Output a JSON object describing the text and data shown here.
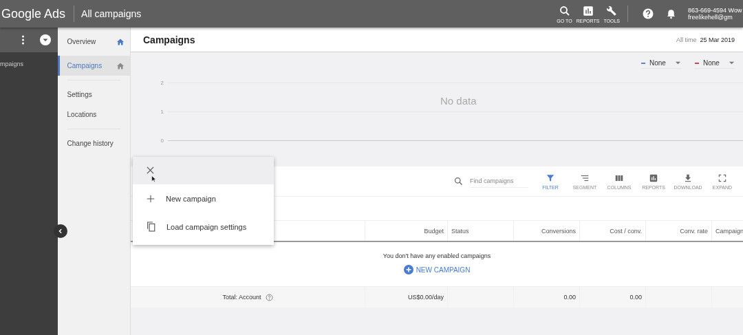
{
  "top_bar": {
    "logo": "Google Ads",
    "title": "All campaigns",
    "actions": [
      {
        "kind": "search",
        "label": "GO TO"
      },
      {
        "kind": "reports",
        "label": "REPORTS"
      },
      {
        "kind": "tools",
        "label": "TOOLS"
      }
    ],
    "account": {
      "phone": "863-669-4594 Wow",
      "email": "freelikehell@gm"
    }
  },
  "account_panel": {
    "item": "mpaigns"
  },
  "nav": [
    {
      "label": "Overview",
      "selected": false,
      "home": true
    },
    {
      "label": "Campaigns",
      "selected": true,
      "home": true
    },
    {
      "kind": "divider"
    },
    {
      "label": "Settings",
      "selected": false,
      "home": false
    },
    {
      "label": "Locations",
      "selected": false,
      "home": false
    },
    {
      "kind": "divider"
    },
    {
      "label": "Change history",
      "selected": false,
      "home": false
    }
  ],
  "header": {
    "title": "Campaigns",
    "range_label": "All time",
    "date": "25 Mar 2019"
  },
  "chart": {
    "metrics": [
      {
        "label": "None",
        "color": "#5a86c9"
      },
      {
        "label": "None",
        "color": "#c4485a"
      }
    ],
    "y_labels": [
      "2",
      "1",
      "0"
    ],
    "empty_message": "No data"
  },
  "toolbar": {
    "search_placeholder": "Find campaigns",
    "buttons": [
      {
        "kind": "filter",
        "label": "FILTER",
        "selected": true
      },
      {
        "kind": "segment",
        "label": "SEGMENT",
        "selected": false
      },
      {
        "kind": "columns",
        "label": "COLUMNS",
        "selected": false
      },
      {
        "kind": "reports",
        "label": "REPORTS",
        "selected": false
      },
      {
        "kind": "download",
        "label": "DOWNLOAD",
        "selected": false
      },
      {
        "kind": "expand",
        "label": "EXPAND",
        "selected": false
      }
    ]
  },
  "table": {
    "columns": [
      "Budget",
      "Status",
      "Conversions",
      "Cost / conv.",
      "Conv. rate",
      "Campaign"
    ],
    "empty_message": "You don't have any enabled campaigns",
    "new_button": "NEW CAMPAIGN",
    "total": {
      "label": "Total: Account",
      "budget": "US$0.00/day",
      "conversions": "0.00",
      "cost_per_conv": "0.00"
    }
  },
  "popup_menu": {
    "items": [
      {
        "kind": "add",
        "label": "New campaign"
      },
      {
        "kind": "copy",
        "label": "Load campaign settings"
      }
    ]
  }
}
